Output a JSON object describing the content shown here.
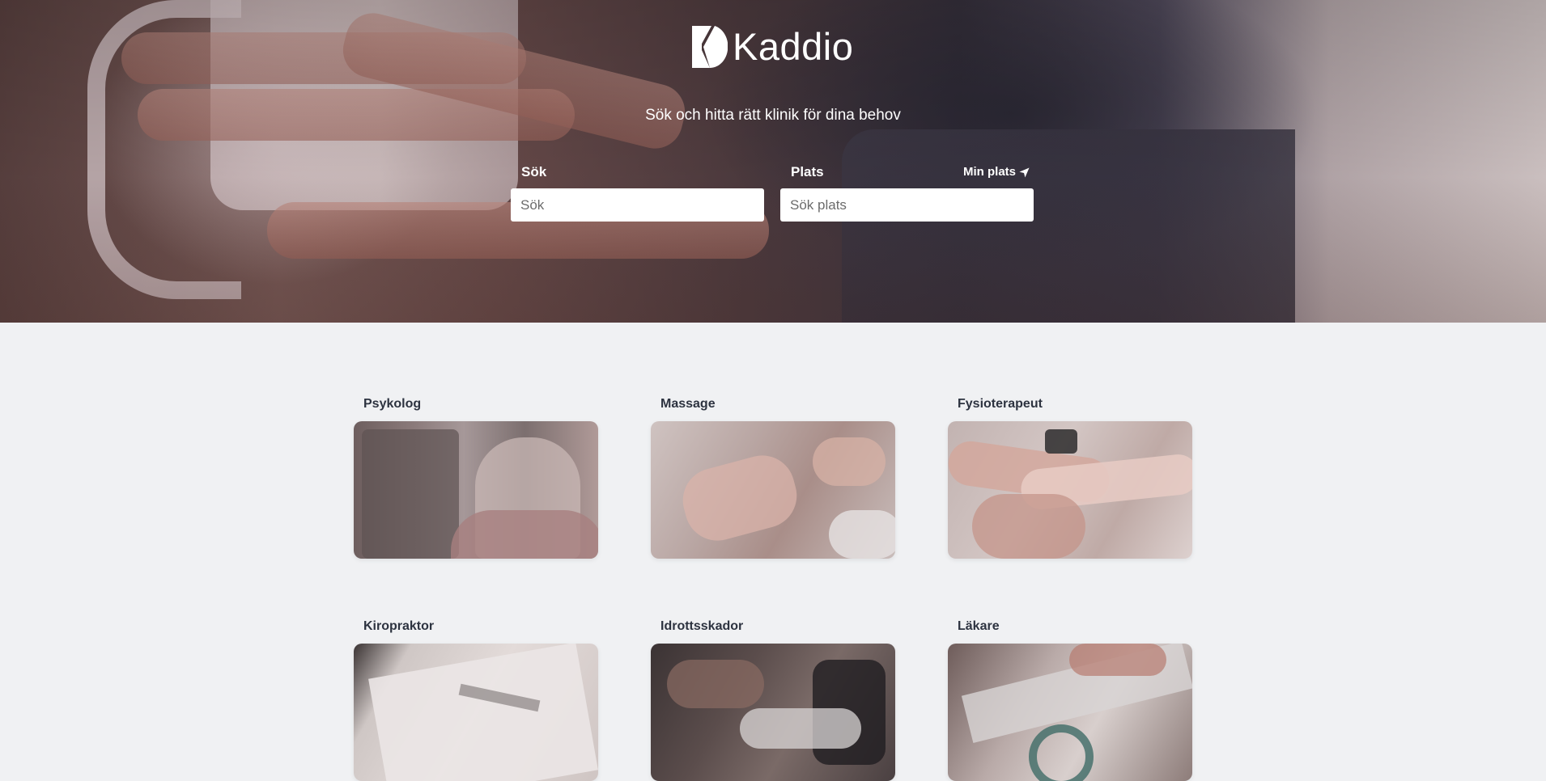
{
  "brand": {
    "name": "Kaddio"
  },
  "hero": {
    "tagline": "Sök och hitta rätt klinik för dina behov",
    "search": {
      "label": "Sök",
      "placeholder": "Sök"
    },
    "location": {
      "label": "Plats",
      "placeholder": "Sök plats",
      "my_location_label": "Min plats",
      "my_location_icon": "location-arrow-icon"
    }
  },
  "categories": [
    {
      "title": "Psykolog"
    },
    {
      "title": "Massage"
    },
    {
      "title": "Fysioterapeut"
    },
    {
      "title": "Kiropraktor"
    },
    {
      "title": "Idrottsskador"
    },
    {
      "title": "Läkare"
    }
  ],
  "colors": {
    "page_background": "#f0f1f3",
    "card_title": "#2d3340",
    "hero_text": "#ffffff"
  }
}
